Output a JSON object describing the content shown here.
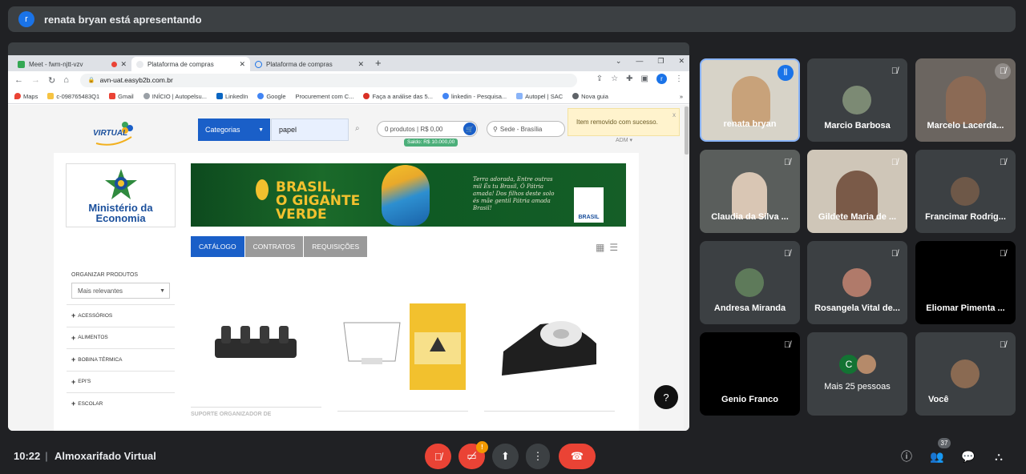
{
  "presenter": {
    "avatar_letter": "r",
    "text": "renata bryan está apresentando"
  },
  "browser": {
    "tabs": [
      {
        "label": "Meet - fwm-njtt-vzv",
        "close": "✕"
      },
      {
        "label": "Plataforma de compras",
        "close": "✕"
      },
      {
        "label": "Plataforma de compras",
        "close": "✕"
      }
    ],
    "new_tab": "+",
    "url": "avn-uat.easyb2b.com.br",
    "profile_letter": "r",
    "bookmarks": [
      "Maps",
      "c-098765483Q1",
      "Gmail",
      "INÍCIO | Autopelsu...",
      "LinkedIn",
      "Google",
      "Procurement com C...",
      "Faça a análise das 5...",
      "linkedin - Pesquisa...",
      "Autopel | SAC",
      "Nova guia"
    ],
    "bookmarks_more": "»"
  },
  "site": {
    "logo_text": "VIRTUAL",
    "categories_label": "Categorias",
    "search_value": "papel",
    "cart_text": "0 produtos | R$ 0,00",
    "saldo": "Saldo: R$ 10.000,00",
    "sede": "Sede - Brasília",
    "toast": "Item removido com sucesso.",
    "toast_close": "x",
    "admin": "ADM ▾",
    "ministry_line1": "Ministério da",
    "ministry_line2": "Economia",
    "banner_title_1": "BRASIL,",
    "banner_title_2": "O GIGANTE",
    "banner_title_3": "VERDE",
    "banner_poem": "Terra adorada, Entre outras mil És tu Brasil, Ó Pátria amada! Dos filhos deste solo és mãe gentil Pátria amada Brasil!",
    "banner_badge": "BRASIL",
    "tabs": [
      "CATÁLOGO",
      "CONTRATOS",
      "REQUISIÇÕES"
    ],
    "organize_label": "ORGANIZAR PRODUTOS",
    "sort_value": "Mais relevantes",
    "categories": [
      "ACESSÓRIOS",
      "ALIMENTOS",
      "BOBINA TÉRMICA",
      "EPI'S",
      "ESCOLAR"
    ],
    "product_hint": "SUPORTE ORGANIZADOR DE",
    "help": "?"
  },
  "participants": [
    {
      "name": "renata bryan",
      "speaking": true
    },
    {
      "name": "Marcio Barbosa"
    },
    {
      "name": "Marcelo Lacerda..."
    },
    {
      "name": "Claudia da Silva ..."
    },
    {
      "name": "Gildete Maria de ..."
    },
    {
      "name": "Francimar Rodrig..."
    },
    {
      "name": "Andresa Miranda"
    },
    {
      "name": "Rosangela Vital de..."
    },
    {
      "name": "Eliomar Pimenta ..."
    },
    {
      "name": "Genio Franco"
    },
    {
      "name": "Mais 25 pessoas",
      "avatar_letter": "C"
    },
    {
      "name": "Você"
    }
  ],
  "bottom": {
    "time": "10:22",
    "meeting": "Almoxarifado Virtual",
    "camera_badge": "!",
    "people_count": "37"
  },
  "colors": {
    "meet_bg": "#202124",
    "tile_bg": "#3c4043",
    "end_call": "#ea4335",
    "site_blue": "#1a5fc8"
  }
}
